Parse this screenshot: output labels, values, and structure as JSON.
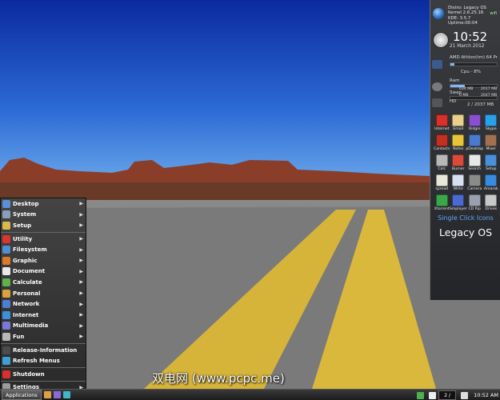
{
  "menu": {
    "items": [
      {
        "label": "Desktop",
        "color": "#5b8fd6",
        "submenu": true
      },
      {
        "label": "System",
        "color": "#8aa0b8",
        "submenu": true
      },
      {
        "label": "Setup",
        "color": "#d9b94a",
        "submenu": true
      },
      {
        "label": "Utility",
        "color": "#d8362e",
        "submenu": true
      },
      {
        "label": "Filesystem",
        "color": "#4f8fd0",
        "submenu": true
      },
      {
        "label": "Graphic",
        "color": "#d97a2a",
        "submenu": true
      },
      {
        "label": "Document",
        "color": "#e8e8e8",
        "submenu": true
      },
      {
        "label": "Calculate",
        "color": "#5fb14c",
        "submenu": true
      },
      {
        "label": "Personal",
        "color": "#d9a23a",
        "submenu": true
      },
      {
        "label": "Network",
        "color": "#4c7fd0",
        "submenu": true
      },
      {
        "label": "Internet",
        "color": "#3e8fd8",
        "submenu": true
      },
      {
        "label": "Multimedia",
        "color": "#7a7ad6",
        "submenu": true
      },
      {
        "label": "Fun",
        "color": "#b7b7b7",
        "submenu": true
      },
      {
        "label": "Release-Information",
        "color": "#4c4c4c",
        "submenu": false
      },
      {
        "label": "Refresh Menus",
        "color": "#3e9fd8",
        "submenu": false
      },
      {
        "label": "Shutdown",
        "color": "#d8302a",
        "submenu": false
      },
      {
        "label": "Settings",
        "color": "#9c9c9c",
        "submenu": true
      }
    ]
  },
  "taskbar": {
    "apps_label": "Applications",
    "pager": "2 /",
    "clock": "10:52 AM",
    "launchers": [
      {
        "icon": "terminal-icon",
        "color": "#e0a040"
      },
      {
        "icon": "media-icon",
        "color": "#8a6ad8"
      },
      {
        "icon": "upload-icon",
        "color": "#3fb7c9"
      }
    ]
  },
  "panel": {
    "sysinfo": [
      "Distro: Legacy OS",
      "Kernel 2.6.25.16",
      "KDE:    3.5.7",
      "Uptime:00:04"
    ],
    "time": "10:52",
    "date": "21 March 2012",
    "cpu_model": "AMD Athlon(tm) 64 Pr",
    "cpu_label": "Cpu - 8%",
    "cpu_pct": 0.08,
    "ram_label": "Ram",
    "ram_value": "634 MB",
    "ram_total": "2017 MB",
    "ram_pct": 0.31,
    "swap_label": "Swap",
    "swap_value": "0 MB",
    "swap_total": "2047 MB",
    "swap_pct": 0.0,
    "hd_label": "HD",
    "hd_value": "2 / 2037 MB",
    "wifi_label": "wifi",
    "apps": [
      {
        "label": "Internet",
        "color": "#d8302a",
        "icon": "opera-icon"
      },
      {
        "label": "Email",
        "color": "#e8d08a",
        "icon": "email-icon"
      },
      {
        "label": "Kidgin",
        "color": "#8a4fd0",
        "icon": "chat-icon"
      },
      {
        "label": "Skype",
        "color": "#2aa0e8",
        "icon": "skype-icon"
      },
      {
        "label": "Contacts",
        "color": "#c43020",
        "icon": "contacts-icon"
      },
      {
        "label": "Notes",
        "color": "#e8c43a",
        "icon": "notes-icon"
      },
      {
        "label": "pDesktop",
        "color": "#4a7ad0",
        "icon": "desktop-icon"
      },
      {
        "label": "Mixer",
        "color": "#a07050",
        "icon": "mixer-icon"
      },
      {
        "label": "Calc",
        "color": "#b8b8b8",
        "icon": "calculator-icon"
      },
      {
        "label": "Burner",
        "color": "#d84a3a",
        "icon": "burner-icon"
      },
      {
        "label": "Search",
        "color": "#e8e8e8",
        "icon": "search-icon"
      },
      {
        "label": "Setup",
        "color": "#4a90d8",
        "icon": "setup-icon"
      },
      {
        "label": "spread",
        "color": "#e8e8d8",
        "icon": "spreadsheet-icon"
      },
      {
        "label": "Write",
        "color": "#d8e0f0",
        "icon": "write-icon"
      },
      {
        "label": "Camera",
        "color": "#8a8a8a",
        "icon": "camera-icon"
      },
      {
        "label": "Amarok",
        "color": "#3a8ae0",
        "icon": "amarok-icon"
      },
      {
        "label": "Xtorrent",
        "color": "#3aa84a",
        "icon": "torrent-icon"
      },
      {
        "label": "Smplayer",
        "color": "#4a6ad0",
        "icon": "player-icon"
      },
      {
        "label": "CD Rip",
        "color": "#9aa0b0",
        "icon": "cd-icon"
      },
      {
        "label": "Drives",
        "color": "#c8c8c8",
        "icon": "drive-icon"
      }
    ],
    "single_click": "Single Click Icons",
    "os_name": "Legacy OS"
  },
  "watermark": "双电网 (www.pcpc.me)"
}
